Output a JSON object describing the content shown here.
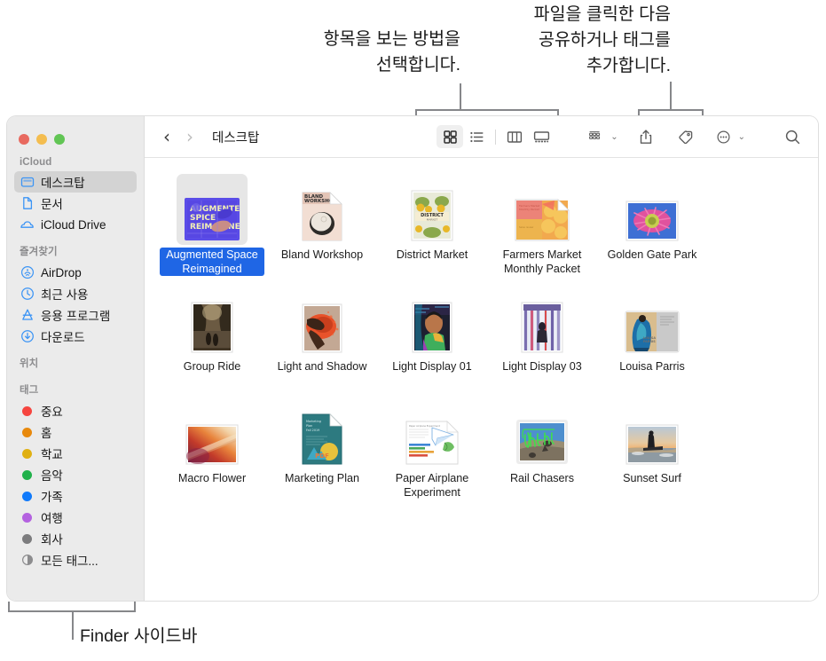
{
  "callouts": {
    "view": "항목을 보는 방법을\n선택합니다.",
    "share": "파일을 클릭한 다음\n공유하거나 태그를\n추가합니다.",
    "sidebar": "Finder 사이드바"
  },
  "window": {
    "traffic_lights": [
      "close",
      "minimize",
      "zoom"
    ],
    "colors": {
      "close": "#e8695f",
      "minimize": "#f4bd4f",
      "zoom": "#61c554",
      "sidebar_bg": "#ebebeb",
      "selection_blue": "#1f66e5",
      "selected_row_bg": "#d3d3d3"
    }
  },
  "toolbar": {
    "back_label": "‹",
    "forward_label": "›",
    "title": "데스크탑",
    "views": [
      {
        "name": "icon-view",
        "label": "아이콘 보기",
        "active": true
      },
      {
        "name": "list-view",
        "label": "목록 보기",
        "active": false
      },
      {
        "name": "column-view",
        "label": "열 보기",
        "active": false
      },
      {
        "name": "gallery-view",
        "label": "갤러리 보기",
        "active": false
      }
    ],
    "actions": [
      {
        "name": "group-by",
        "label": "그룹별 정렬",
        "has_chevron": true
      },
      {
        "name": "share",
        "label": "공유",
        "has_chevron": false
      },
      {
        "name": "tags",
        "label": "태그",
        "has_chevron": false
      },
      {
        "name": "more",
        "label": "더 보기",
        "has_chevron": true
      }
    ],
    "search_label": "검색",
    "chevron_glyph": "⌄"
  },
  "sidebar": {
    "sections": [
      {
        "title": "iCloud",
        "items": [
          {
            "label": "데스크탑",
            "icon": "desktop-icon",
            "selected": true
          },
          {
            "label": "문서",
            "icon": "document-icon",
            "selected": false
          },
          {
            "label": "iCloud Drive",
            "icon": "cloud-icon",
            "selected": false
          }
        ]
      },
      {
        "title": "즐겨찾기",
        "items": [
          {
            "label": "AirDrop",
            "icon": "airdrop-icon",
            "selected": false
          },
          {
            "label": "최근 사용",
            "icon": "clock-icon",
            "selected": false
          },
          {
            "label": "응용 프로그램",
            "icon": "applications-icon",
            "selected": false
          },
          {
            "label": "다운로드",
            "icon": "downloads-icon",
            "selected": false
          }
        ]
      },
      {
        "title": "위치",
        "items": []
      },
      {
        "title": "태그",
        "items": [
          {
            "label": "중요",
            "icon": "tag-dot",
            "color": "#f6453f",
            "selected": false
          },
          {
            "label": "홈",
            "icon": "tag-dot",
            "color": "#e8890c",
            "selected": false
          },
          {
            "label": "학교",
            "icon": "tag-dot",
            "color": "#e0b012",
            "selected": false
          },
          {
            "label": "음악",
            "icon": "tag-dot",
            "color": "#21b14b",
            "selected": false
          },
          {
            "label": "가족",
            "icon": "tag-dot",
            "color": "#107afb",
            "selected": false
          },
          {
            "label": "여행",
            "icon": "tag-dot",
            "color": "#b462e0",
            "selected": false
          },
          {
            "label": "회사",
            "icon": "tag-dot",
            "color": "#7c7c7e",
            "selected": false
          },
          {
            "label": "모든 태그...",
            "icon": "all-tags-icon",
            "color": "#8c8c8e",
            "selected": false
          }
        ]
      }
    ]
  },
  "files": [
    {
      "name": "Augmented Space Reimagined",
      "kind": "keynote",
      "selected": true
    },
    {
      "name": "Bland Workshop",
      "kind": "pages-doc",
      "selected": false
    },
    {
      "name": "District Market",
      "kind": "photo-market",
      "selected": false
    },
    {
      "name": "Farmers Market Monthly Packet",
      "kind": "pages-fruit",
      "selected": false
    },
    {
      "name": "Golden Gate Park",
      "kind": "photo-flower",
      "selected": false
    },
    {
      "name": "Group Ride",
      "kind": "photo-ride",
      "selected": false
    },
    {
      "name": "Light and Shadow",
      "kind": "photo-shadow",
      "selected": false
    },
    {
      "name": "Light Display 01",
      "kind": "photo-portrait",
      "selected": false
    },
    {
      "name": "Light Display 03",
      "kind": "photo-stripes",
      "selected": false
    },
    {
      "name": "Louisa Parris",
      "kind": "pages-louisa",
      "selected": false
    },
    {
      "name": "Macro Flower",
      "kind": "photo-macro",
      "selected": false
    },
    {
      "name": "Marketing Plan",
      "kind": "pdf",
      "selected": false
    },
    {
      "name": "Paper Airplane Experiment",
      "kind": "numbers",
      "selected": false
    },
    {
      "name": "Rail Chasers",
      "kind": "photo-rail",
      "selected": false
    },
    {
      "name": "Sunset Surf",
      "kind": "photo-surf",
      "selected": false
    }
  ]
}
